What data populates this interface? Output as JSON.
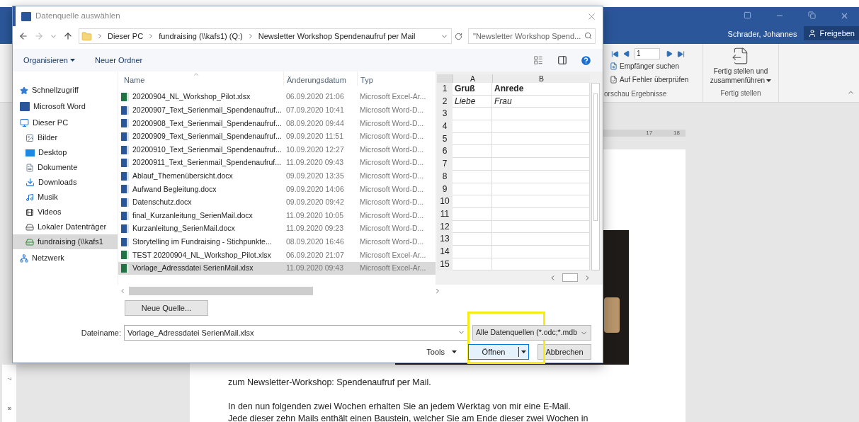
{
  "word": {
    "user": "Schrader, Johannes",
    "share_button": "Freigeben",
    "ribbon": {
      "record_field": "1",
      "find_recipient": "Empfänger suchen",
      "check_errors": "Auf Fehler überprüfen",
      "preview_group_label": "orschau Ergebnisse",
      "finish_button": "Fertig stellen und zusammenführen",
      "finish_group_label": "Fertig stellen"
    },
    "ruler_labels": [
      "17",
      "18"
    ],
    "vertical_ruler_labels": [
      "7",
      "8"
    ],
    "document_lines": [
      "zum Newsletter-Workshop: Spendenaufruf per Mail.",
      "In den nun folgenden zwei Wochen erhalten Sie an jedem Werktag von mir eine E-Mail.",
      "Jede dieser zehn Mails enthält einen Baustein, welcher Sie am Ende dieser zwei Wochen in"
    ]
  },
  "dialog": {
    "title": "Datenquelle auswählen",
    "breadcrumbs": [
      "Dieser PC",
      "fundraising (\\\\kafs1) (Q:)",
      "Newsletter Workshop Spendenaufruf per Mail"
    ],
    "search": {
      "placeholder": "\"Newsletter Workshop Spend..."
    },
    "toolbar": {
      "organize": "Organisieren",
      "new_folder": "Neuer Ordner"
    },
    "nav": [
      {
        "label": "Schnellzugriff",
        "kind": "star",
        "selected": false
      },
      {
        "label": "Microsoft Word",
        "kind": "word",
        "selected": false
      },
      {
        "label": "Dieser PC",
        "kind": "pc",
        "selected": false,
        "children": [
          {
            "label": "Bilder",
            "kind": "pictures",
            "selected": false
          },
          {
            "label": "Desktop",
            "kind": "desktop",
            "selected": false
          },
          {
            "label": "Dokumente",
            "kind": "documents",
            "selected": false
          },
          {
            "label": "Downloads",
            "kind": "downloads",
            "selected": false
          },
          {
            "label": "Musik",
            "kind": "music",
            "selected": false
          },
          {
            "label": "Videos",
            "kind": "videos",
            "selected": false
          },
          {
            "label": "Lokaler Datenträger",
            "kind": "drive",
            "selected": false
          },
          {
            "label": "fundraising (\\\\kafs1",
            "kind": "netdrive",
            "selected": true
          }
        ]
      },
      {
        "label": "Netzwerk",
        "kind": "network",
        "selected": false
      }
    ],
    "columns": [
      "Name",
      "Änderungsdatum",
      "Typ"
    ],
    "files": [
      {
        "name": "20200904_NL_Workshop_Pilot.xlsx",
        "date": "06.09.2020 21:06",
        "type": "Microsoft Excel-Ar...",
        "kind": "excel",
        "selected": false
      },
      {
        "name": "20200907_Text_Serienmail_Spendenaufruf...",
        "date": "07.09.2020 10:41",
        "type": "Microsoft Word-D...",
        "kind": "word",
        "selected": false
      },
      {
        "name": "20200908_Text_Serienmail_Spendenaufruf...",
        "date": "08.09.2020 09:44",
        "type": "Microsoft Word-D...",
        "kind": "word",
        "selected": false
      },
      {
        "name": "20200909_Text_Serienmail_Spendenaufruf...",
        "date": "09.09.2020 11:51",
        "type": "Microsoft Word-D...",
        "kind": "word",
        "selected": false
      },
      {
        "name": "20200910_Text_Serienmail_Spendenaufruf...",
        "date": "10.09.2020 12:27",
        "type": "Microsoft Word-D...",
        "kind": "word",
        "selected": false
      },
      {
        "name": "20200911_Text_Serienmail_Spendenaufruf...",
        "date": "11.09.2020 09:43",
        "type": "Microsoft Word-D...",
        "kind": "word",
        "selected": false
      },
      {
        "name": "Ablauf_Themenübersicht.docx",
        "date": "09.09.2020 13:35",
        "type": "Microsoft Word-D...",
        "kind": "word",
        "selected": false
      },
      {
        "name": "Aufwand Begleitung.docx",
        "date": "09.09.2020 14:06",
        "type": "Microsoft Word-D...",
        "kind": "word",
        "selected": false
      },
      {
        "name": "Datenschutz.docx",
        "date": "09.09.2020 09:42",
        "type": "Microsoft Word-D...",
        "kind": "word",
        "selected": false
      },
      {
        "name": "final_Kurzanleitung_SerienMail.docx",
        "date": "11.09.2020 10:05",
        "type": "Microsoft Word-D...",
        "kind": "word",
        "selected": false
      },
      {
        "name": "Kurzanleitung_SerienMail.docx",
        "date": "11.09.2020 09:23",
        "type": "Microsoft Word-D...",
        "kind": "word",
        "selected": false
      },
      {
        "name": "Storytelling im Fundraising - Stichpunkte...",
        "date": "08.09.2020 16:46",
        "type": "Microsoft Word-D...",
        "kind": "word",
        "selected": false
      },
      {
        "name": "TEST 20200904_NL_Workshop_Pilot.xlsx",
        "date": "06.09.2020 21:07",
        "type": "Microsoft Excel-Ar...",
        "kind": "excel",
        "selected": false
      },
      {
        "name": "Vorlage_Adressdatei SerienMail.xlsx",
        "date": "11.09.2020 09:43",
        "type": "Microsoft Excel-Ar...",
        "kind": "excel",
        "selected": true
      }
    ],
    "preview": {
      "columns": [
        "A",
        "B"
      ],
      "rows": [
        {
          "number": "1",
          "cells": [
            "Gruß",
            "Anrede"
          ],
          "kind": "header"
        },
        {
          "number": "2",
          "cells": [
            "Liebe",
            "Frau"
          ],
          "kind": "sample"
        },
        {
          "number": "3"
        },
        {
          "number": "4"
        },
        {
          "number": "5"
        },
        {
          "number": "6"
        },
        {
          "number": "7"
        },
        {
          "number": "8"
        },
        {
          "number": "9"
        },
        {
          "number": "10"
        },
        {
          "number": "11"
        },
        {
          "number": "12"
        },
        {
          "number": "13"
        },
        {
          "number": "14"
        },
        {
          "number": "15"
        }
      ]
    },
    "new_source_button": "Neue Quelle...",
    "filename_label": "Dateiname:",
    "filename_value": "Vorlage_Adressdatei SerienMail.xlsx",
    "filter": "Alle Datenquellen (*.odc;*.mdb",
    "tools": "Tools",
    "open_button": "Öffnen",
    "cancel_button": "Abbrechen"
  }
}
